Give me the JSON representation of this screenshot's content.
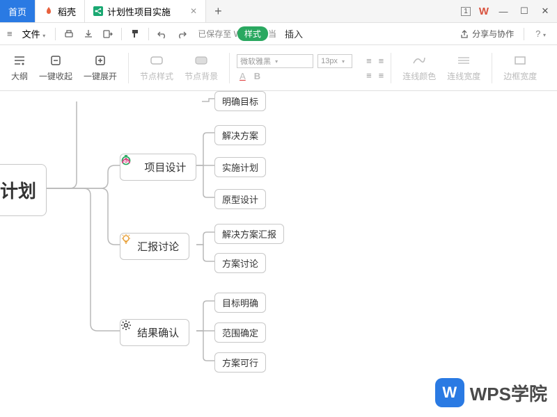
{
  "titlebar": {
    "tab_home": "首页",
    "tab_docker": "稻壳",
    "tab_doc": "计划性项目实施",
    "win_count": "1"
  },
  "menubar": {
    "file": "文件",
    "saved_label": "已保存至 W",
    "style": "样式",
    "after": "当",
    "insert": "插入",
    "share": "分享与协作"
  },
  "toolbar": {
    "outline": "大纲",
    "collapse": "一键收起",
    "expand": "一键展开",
    "node_style": "节点样式",
    "node_bg": "节点背景",
    "font_name": "微软雅黑",
    "font_size": "13px",
    "line_color": "连线颜色",
    "line_width": "连线宽度",
    "border_width": "边框宽度"
  },
  "mindmap": {
    "root": "计划",
    "n_goal": "明确目标",
    "b_design": "项目设计",
    "d1": "解决方案",
    "d2": "实施计划",
    "d3": "原型设计",
    "b_report": "汇报讨论",
    "r1": "解决方案汇报",
    "r2": "方案讨论",
    "b_confirm": "结果确认",
    "c1": "目标明确",
    "c2": "范围确定",
    "c3": "方案可行"
  },
  "watermark": "WPS学院"
}
